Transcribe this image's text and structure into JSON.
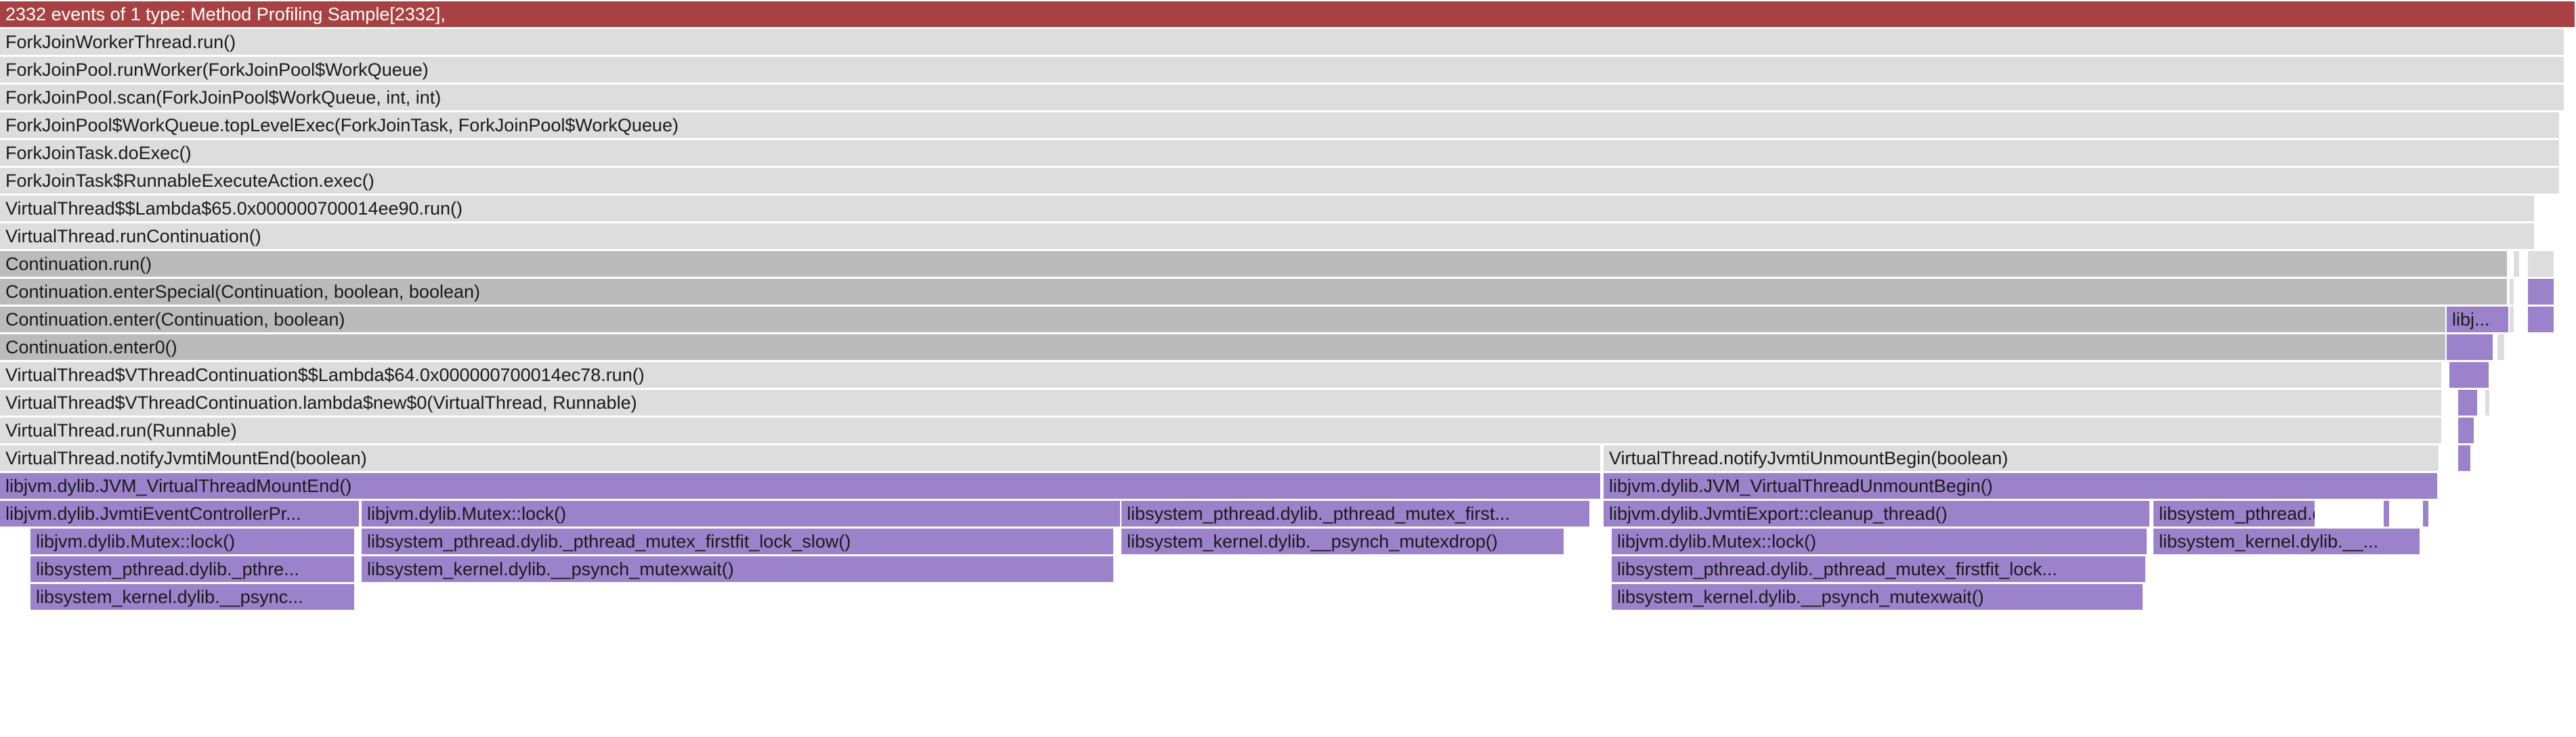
{
  "header": {
    "summary": "2332 events of 1 type: Method Profiling Sample[2332],"
  },
  "colors": {
    "root": "#a84242",
    "java": "#dddddd",
    "continuation": "#bbbbbb",
    "native": "#9b82ca"
  },
  "frames": [
    {
      "row": 1,
      "label": "ForkJoinWorkerThread.run()",
      "kind": "java"
    },
    {
      "row": 2,
      "label": "ForkJoinPool.runWorker(ForkJoinPool$WorkQueue)",
      "kind": "java"
    },
    {
      "row": 3,
      "label": "ForkJoinPool.scan(ForkJoinPool$WorkQueue, int, int)",
      "kind": "java"
    },
    {
      "row": 4,
      "label": "ForkJoinPool$WorkQueue.topLevelExec(ForkJoinTask, ForkJoinPool$WorkQueue)",
      "kind": "java"
    },
    {
      "row": 5,
      "label": "ForkJoinTask.doExec()",
      "kind": "java"
    },
    {
      "row": 6,
      "label": "ForkJoinTask$RunnableExecuteAction.exec()",
      "kind": "java"
    },
    {
      "row": 7,
      "label": "VirtualThread$$Lambda$65.0x000000700014ee90.run()",
      "kind": "java"
    },
    {
      "row": 8,
      "label": "VirtualThread.runContinuation()",
      "kind": "java"
    },
    {
      "row": 9,
      "label": "Continuation.run()",
      "kind": "cont"
    },
    {
      "row": 10,
      "label": "Continuation.enterSpecial(Continuation, boolean, boolean)",
      "kind": "cont"
    },
    {
      "row": 11,
      "label": "Continuation.enter(Continuation, boolean)",
      "kind": "cont"
    },
    {
      "row": 11,
      "label": "libj...",
      "kind": "native"
    },
    {
      "row": 12,
      "label": "Continuation.enter0()",
      "kind": "cont"
    },
    {
      "row": 13,
      "label": "VirtualThread$VThreadContinuation$$Lambda$64.0x000000700014ec78.run()",
      "kind": "java"
    },
    {
      "row": 14,
      "label": "VirtualThread$VThreadContinuation.lambda$new$0(VirtualThread, Runnable)",
      "kind": "java"
    },
    {
      "row": 15,
      "label": "VirtualThread.run(Runnable)",
      "kind": "java"
    },
    {
      "row": 16,
      "label": "VirtualThread.notifyJvmtiMountEnd(boolean)",
      "kind": "java"
    },
    {
      "row": 16,
      "label": "VirtualThread.notifyJvmtiUnmountBegin(boolean)",
      "kind": "java"
    },
    {
      "row": 17,
      "label": "libjvm.dylib.JVM_VirtualThreadMountEnd()",
      "kind": "native"
    },
    {
      "row": 17,
      "label": "libjvm.dylib.JVM_VirtualThreadUnmountBegin()",
      "kind": "native"
    },
    {
      "row": 18,
      "label": "libjvm.dylib.JvmtiEventControllerPr...",
      "kind": "native"
    },
    {
      "row": 18,
      "label": "libjvm.dylib.Mutex::lock()",
      "kind": "native"
    },
    {
      "row": 18,
      "label": "libsystem_pthread.dylib._pthread_mutex_first...",
      "kind": "native"
    },
    {
      "row": 18,
      "label": "libjvm.dylib.JvmtiExport::cleanup_thread()",
      "kind": "native"
    },
    {
      "row": 18,
      "label": "libsystem_pthread.dylib....",
      "kind": "native"
    },
    {
      "row": 19,
      "label": "libjvm.dylib.Mutex::lock()",
      "kind": "native"
    },
    {
      "row": 19,
      "label": "libsystem_pthread.dylib._pthread_mutex_firstfit_lock_slow()",
      "kind": "native"
    },
    {
      "row": 19,
      "label": "libsystem_kernel.dylib.__psynch_mutexdrop()",
      "kind": "native"
    },
    {
      "row": 19,
      "label": "libjvm.dylib.Mutex::lock()",
      "kind": "native"
    },
    {
      "row": 19,
      "label": "libsystem_kernel.dylib.__...",
      "kind": "native"
    },
    {
      "row": 20,
      "label": "libsystem_pthread.dylib._pthre...",
      "kind": "native"
    },
    {
      "row": 20,
      "label": "libsystem_kernel.dylib.__psynch_mutexwait()",
      "kind": "native"
    },
    {
      "row": 20,
      "label": "libsystem_pthread.dylib._pthread_mutex_firstfit_lock...",
      "kind": "native"
    },
    {
      "row": 21,
      "label": "libsystem_kernel.dylib.__psync...",
      "kind": "native"
    },
    {
      "row": 21,
      "label": "libsystem_kernel.dylib.__psynch_mutexwait()",
      "kind": "native"
    },
    {
      "row": 9,
      "label": "",
      "kind": "java"
    },
    {
      "row": 9,
      "label": "",
      "kind": "java"
    },
    {
      "row": 10,
      "label": "",
      "kind": "java"
    },
    {
      "row": 10,
      "label": "",
      "kind": "native"
    },
    {
      "row": 11,
      "label": "",
      "kind": "java"
    },
    {
      "row": 11,
      "label": "",
      "kind": "native"
    },
    {
      "row": 12,
      "label": "",
      "kind": "native"
    },
    {
      "row": 12,
      "label": "",
      "kind": "java"
    },
    {
      "row": 13,
      "label": "",
      "kind": "native"
    },
    {
      "row": 14,
      "label": "",
      "kind": "native"
    },
    {
      "row": 14,
      "label": "",
      "kind": "java"
    },
    {
      "row": 15,
      "label": "",
      "kind": "native"
    },
    {
      "row": 16,
      "label": "",
      "kind": "native"
    },
    {
      "row": 18,
      "label": "",
      "kind": "native"
    },
    {
      "row": 18,
      "label": "",
      "kind": "native"
    }
  ]
}
